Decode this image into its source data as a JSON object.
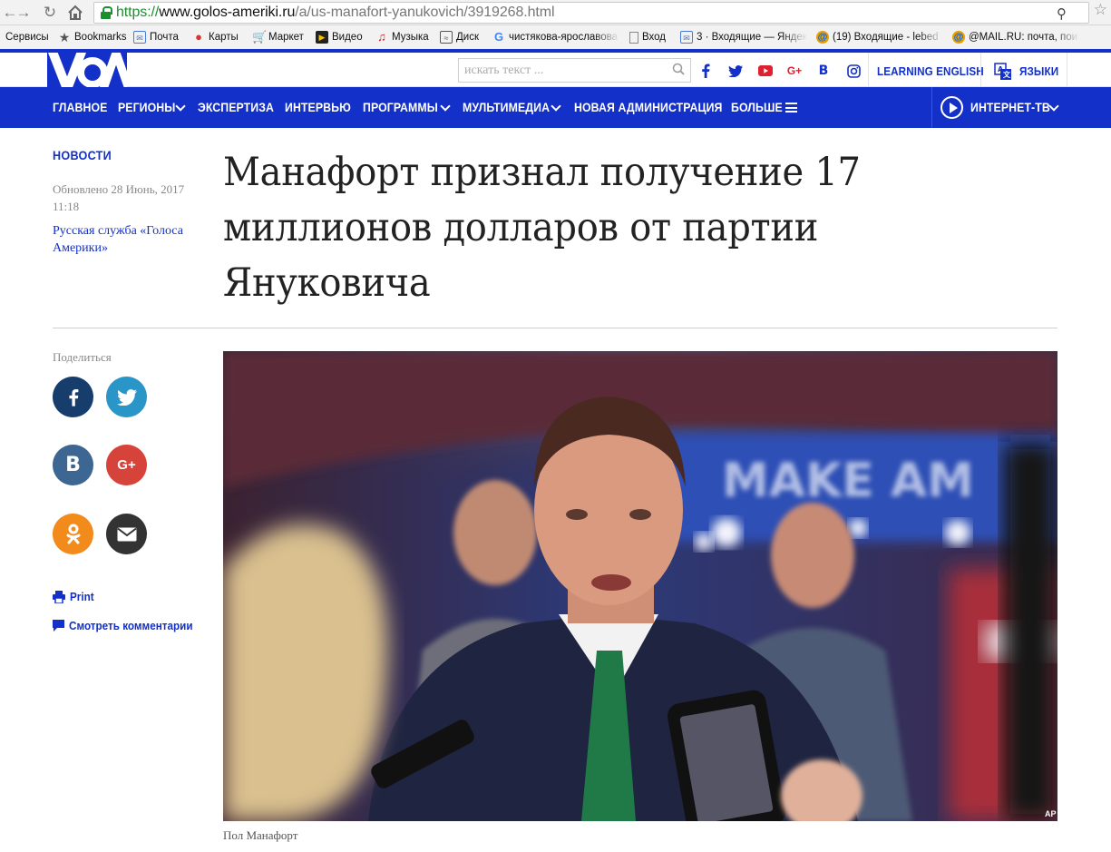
{
  "browser": {
    "url_scheme": "https://",
    "url_host": "www.golos-ameriki.ru",
    "url_path": "/a/us-manafort-yanukovich/3919268.html",
    "bookmarks": [
      {
        "label": "Сервисы"
      },
      {
        "label": "Bookmarks"
      },
      {
        "label": "Почта"
      },
      {
        "label": "Карты"
      },
      {
        "label": "Маркет"
      },
      {
        "label": "Видео"
      },
      {
        "label": "Музыка"
      },
      {
        "label": "Диск"
      },
      {
        "label": "чистякова-ярославова"
      },
      {
        "label": "Вход"
      },
      {
        "label": "3 · Входящие — Яндек"
      },
      {
        "label": "(19) Входящие - lebed"
      },
      {
        "label": "@MAIL.RU: почта, пои"
      }
    ]
  },
  "site": {
    "logo": "VOA",
    "search_placeholder": "искать текст ...",
    "social_icons": [
      "facebook-icon",
      "twitter-icon",
      "youtube-icon",
      "google-plus-icon",
      "vk-icon",
      "instagram-icon"
    ],
    "learning_english": "LEARNING ENGLISH",
    "languages": "ЯЗЫКИ",
    "brand_color": "#1330c8"
  },
  "nav": {
    "items": [
      {
        "label": "ГЛАВНОЕ"
      },
      {
        "label": "РЕГИОНЫ"
      },
      {
        "label": "ЭКСПЕРТИЗА"
      },
      {
        "label": "ИНТЕРВЬЮ"
      },
      {
        "label": "ПРОГРАММЫ"
      },
      {
        "label": "МУЛЬТИМЕДИА"
      },
      {
        "label": "НОВАЯ АДМИНИСТРАЦИЯ"
      },
      {
        "label": "БОЛЬШЕ"
      }
    ],
    "tv": "ИНТЕРНЕТ-ТВ"
  },
  "article": {
    "section": "НОВОСТИ",
    "updated": "Обновлено 28 Июнь, 2017 11:18",
    "author": "Русская служба «Голоса Америки»",
    "headline": "Манафорт признал получение 17 миллионов долларов от партии Януковича",
    "share_label": "Поделиться",
    "print": "Print",
    "comments": "Смотреть комментарии",
    "photo_credit": "AP",
    "photo_sign_text": "MAKE AM",
    "caption": "Пол Манафорт"
  }
}
